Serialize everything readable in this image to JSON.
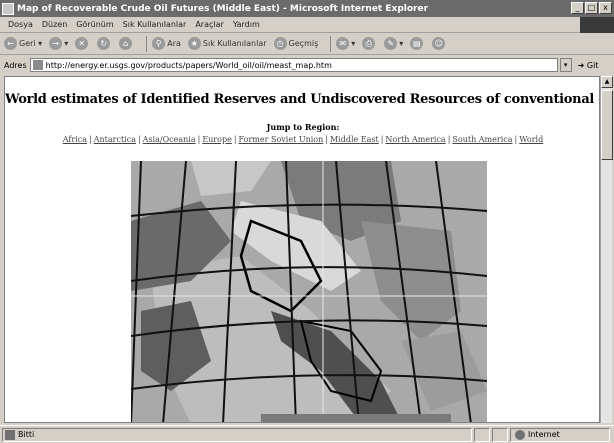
{
  "window": {
    "title": "Map of Recoverable Crude Oil Futures (Middle East) - Microsoft Internet Explorer",
    "minimize": "_",
    "maximize": "□",
    "close": "x"
  },
  "menu": [
    "Dosya",
    "Düzen",
    "Görünüm",
    "Sık Kullanılanlar",
    "Araçlar",
    "Yardım"
  ],
  "toolbar": {
    "back_label": "Geri",
    "search_label": "Ara",
    "favorites_label": "Sık Kullanılanlar",
    "history_label": "Geçmiş"
  },
  "address": {
    "label": "Adres",
    "url": "http://energy.er.usgs.gov/products/papers/World_oil/oil/meast_map.htm",
    "go_label": "Git"
  },
  "page": {
    "title": "World estimates of Identified Reserves and Undiscovered Resources of conventional crude oil",
    "jump_label": "Jump to Region:",
    "regions": [
      "Africa",
      "Antarctica",
      "Asia/Oceania",
      "Europe",
      "Former Soviet Union",
      "Middle East",
      "North America",
      "South America",
      "World"
    ]
  },
  "status": {
    "left_text": "Bitti",
    "zone_text": "Internet"
  },
  "colors": {
    "titlebar": "#6b6b6b",
    "chrome": "#d4d0c8",
    "map_background": "#a9a9a9"
  }
}
